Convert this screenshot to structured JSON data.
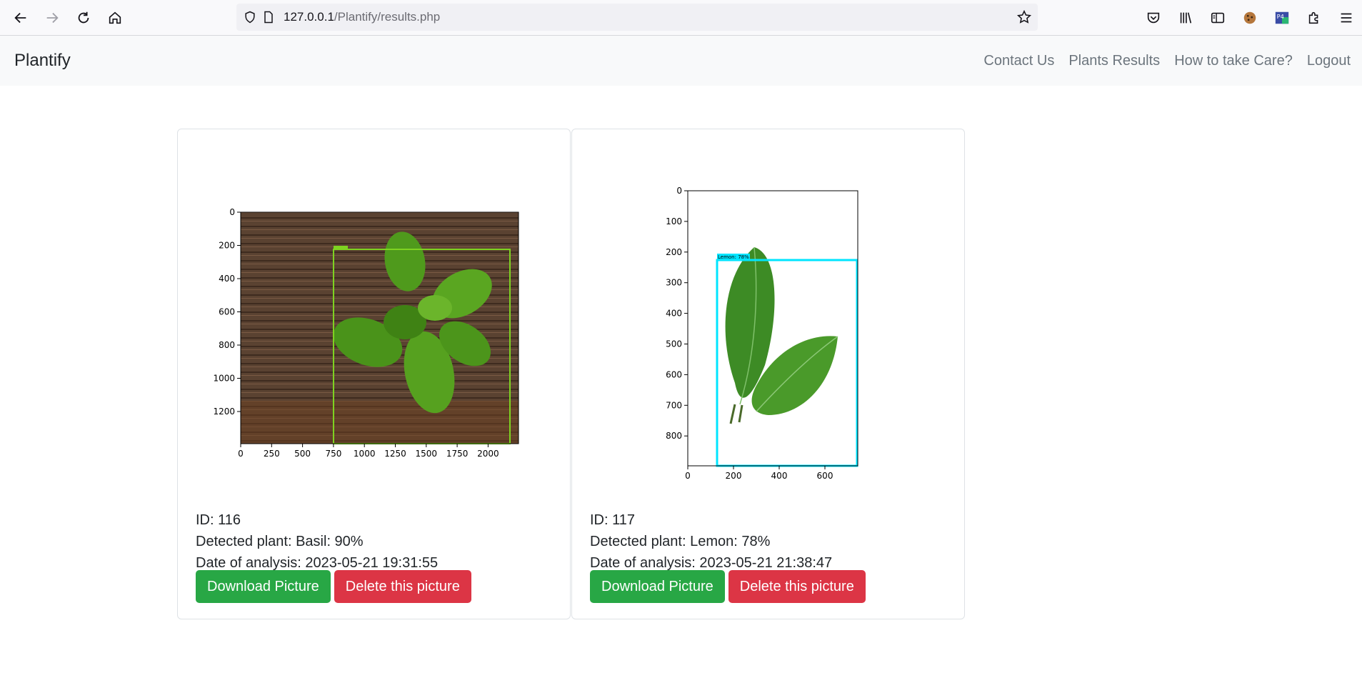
{
  "browser": {
    "url_host": "127.0.0.1",
    "url_path": "/Plantify/results.php",
    "icons": [
      "back-arrow-icon",
      "forward-arrow-icon",
      "reload-icon",
      "home-icon",
      "shield-icon",
      "page-icon",
      "bookmark-star-icon",
      "pocket-icon",
      "library-icon",
      "sidebar-icon",
      "cookie-icon",
      "extension-p4c-icon",
      "extensions-puzzle-icon",
      "menu-hamburger-icon"
    ]
  },
  "navbar": {
    "brand": "Plantify",
    "links": [
      "Contact Us",
      "Plants Results",
      "How to take Care?",
      "Logout"
    ]
  },
  "cards": [
    {
      "id_text": "ID: 116",
      "detected_text": "Detected plant: Basil: 90%",
      "date_text": "Date of analysis: 2023-05-21 19:31:55",
      "download_label": "Download Picture",
      "delete_label": "Delete this picture",
      "plot": {
        "y_ticks": [
          "0",
          "200",
          "400",
          "600",
          "800",
          "1000",
          "1200"
        ],
        "x_ticks": [
          "0",
          "250",
          "500",
          "750",
          "1000",
          "1250",
          "1500",
          "1750",
          "2000"
        ],
        "box_color": "#7ed321"
      }
    },
    {
      "id_text": "ID: 117",
      "detected_text": "Detected plant: Lemon: 78%",
      "date_text": "Date of analysis: 2023-05-21 21:38:47",
      "download_label": "Download Picture",
      "delete_label": "Delete this picture",
      "plot": {
        "y_ticks": [
          "0",
          "100",
          "200",
          "300",
          "400",
          "500",
          "600",
          "700",
          "800"
        ],
        "x_ticks": [
          "0",
          "200",
          "400",
          "600"
        ],
        "box_label": "Lemon: 78%",
        "box_color": "#00e5ff"
      }
    }
  ]
}
